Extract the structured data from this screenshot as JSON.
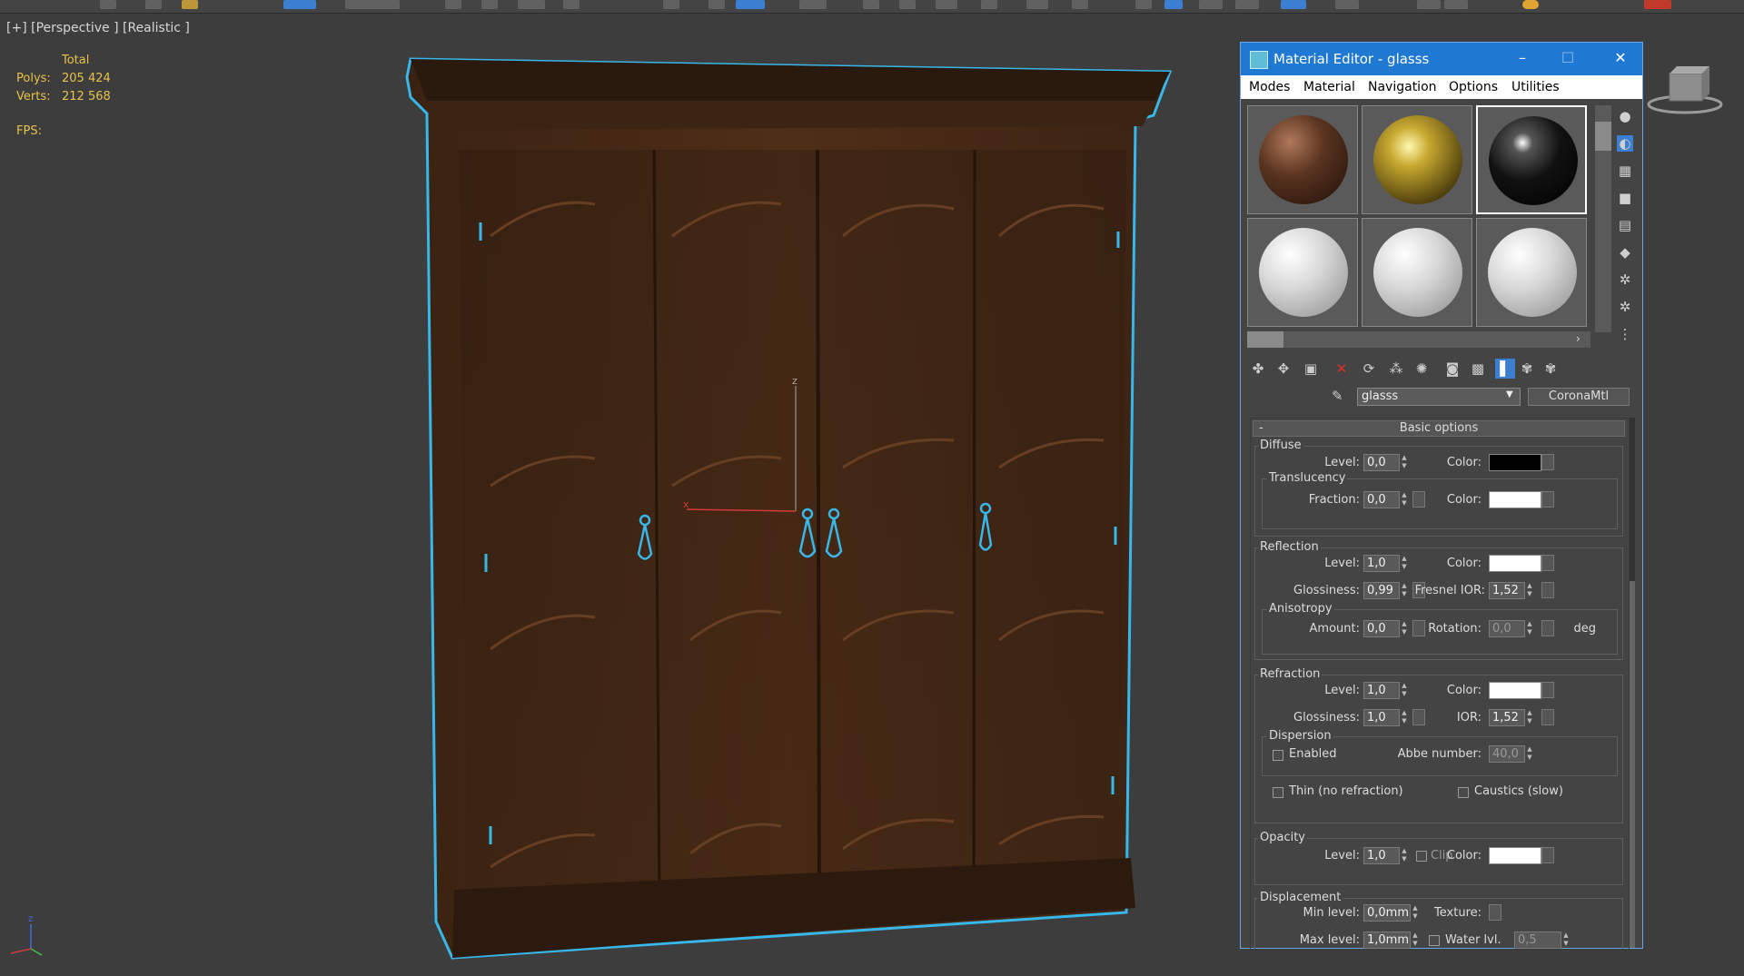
{
  "viewport": {
    "label": "[+] [Perspective ] [Realistic ]",
    "stats": {
      "header": "Total",
      "polys_label": "Polys:",
      "polys_value": "205 424",
      "verts_label": "Verts:",
      "verts_value": "212 568"
    },
    "fps_label": "FPS:",
    "axis_labels": {
      "x": "x",
      "z": "z"
    }
  },
  "material_editor": {
    "title": "Material Editor - glasss",
    "window_buttons": {
      "minimize": "–",
      "maximize": "☐",
      "close": "✕"
    },
    "menu": [
      "Modes",
      "Material",
      "Navigation",
      "Options",
      "Utilities"
    ],
    "slots": [
      {
        "material": "dark wood",
        "color": "#5a3420"
      },
      {
        "material": "gold",
        "color": "#8a7320"
      },
      {
        "material": "glass",
        "color": "#111111"
      },
      {
        "material": "default",
        "color": "#d8d8d8"
      },
      {
        "material": "default",
        "color": "#d8d8d8"
      },
      {
        "material": "default",
        "color": "#d8d8d8"
      }
    ],
    "material_name": "glasss",
    "material_type": "CoronaMtl",
    "rollout_title": "Basic options",
    "diffuse": {
      "title": "Diffuse",
      "level_label": "Level:",
      "level": "0,0",
      "color_label": "Color:",
      "color": "#000000",
      "translucency": {
        "title": "Translucency",
        "fraction_label": "Fraction:",
        "fraction": "0,0",
        "color_label": "Color:",
        "color": "#ffffff"
      }
    },
    "reflection": {
      "title": "Reflection",
      "level_label": "Level:",
      "level": "1,0",
      "color_label": "Color:",
      "color": "#ffffff",
      "glossiness_label": "Glossiness:",
      "glossiness": "0,99",
      "fresnel_label": "Fresnel IOR:",
      "fresnel": "1,52",
      "anisotropy": {
        "title": "Anisotropy",
        "amount_label": "Amount:",
        "amount": "0,0",
        "rotation_label": "Rotation:",
        "rotation": "0,0",
        "rotation_unit": "deg"
      }
    },
    "refraction": {
      "title": "Refraction",
      "level_label": "Level:",
      "level": "1,0",
      "color_label": "Color:",
      "color": "#ffffff",
      "glossiness_label": "Glossiness:",
      "glossiness": "1,0",
      "ior_label": "IOR:",
      "ior": "1,52",
      "dispersion": {
        "title": "Dispersion",
        "enabled_label": "Enabled",
        "enabled": false,
        "abbe_label": "Abbe number:",
        "abbe": "40,0"
      },
      "thin_label": "Thin (no refraction)",
      "thin": false,
      "caustics_label": "Caustics (slow)",
      "caustics": false
    },
    "opacity": {
      "title": "Opacity",
      "level_label": "Level:",
      "level": "1,0",
      "clip_label": "Clip",
      "clip": false,
      "color_label": "Color:",
      "color": "#ffffff"
    },
    "displacement": {
      "title": "Displacement",
      "min_label": "Min level:",
      "min": "0,0mm",
      "texture_label": "Texture:",
      "max_label": "Max level:",
      "max": "1,0mm",
      "water_label": "Water lvl.",
      "water": "0,5"
    }
  }
}
